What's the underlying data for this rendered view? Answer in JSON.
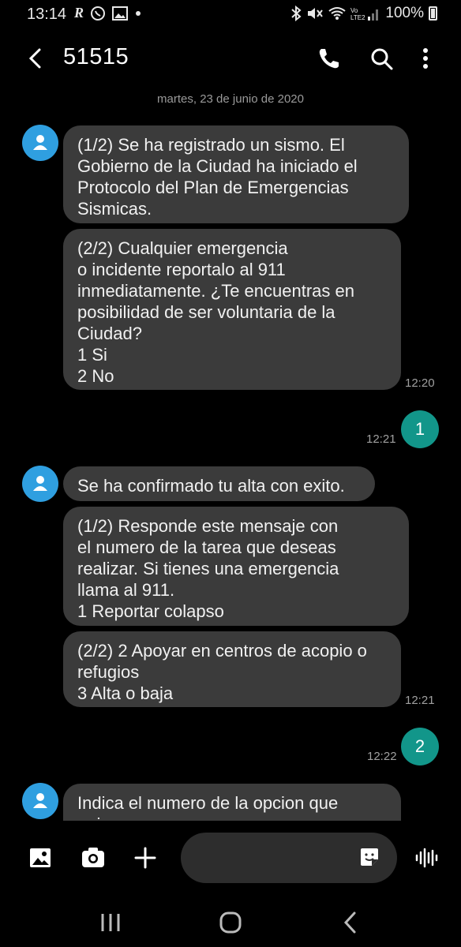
{
  "status_bar": {
    "time": "13:14",
    "battery": "100%",
    "app_icons": [
      "R",
      "whatsapp-icon",
      "gallery-icon",
      "dot-icon"
    ]
  },
  "header": {
    "title": "51515"
  },
  "date_separator": "martes, 23 de junio de 2020",
  "messages": [
    {
      "text": "(1/2) Se ha registrado un sismo. El\nGobierno de la Ciudad ha iniciado el\nProtocolo del Plan de Emergencias\nSismicas."
    },
    {
      "text": "(2/2) Cualquier emergencia\no incidente reportalo al 911\ninmediatamente. ¿Te encuentras en\nposibilidad de ser voluntaria de la\nCiudad?\n1 Si\n2 No",
      "time": "12:20"
    },
    {
      "sent": "1",
      "time": "12:21"
    },
    {
      "text": "Se ha confirmado tu alta con exito."
    },
    {
      "text": "(1/2) Responde este mensaje con\nel numero de la tarea que deseas\nrealizar. Si tienes una emergencia\nllama al 911.\n1 Reportar colapso"
    },
    {
      "text": "(2/2) 2 Apoyar en centros de acopio o\nrefugios\n3 Alta o baja",
      "time": "12:21"
    },
    {
      "sent": "2",
      "time": "12:22"
    },
    {
      "text": "Indica el numero de la opcion que\nquieres"
    }
  ],
  "input": {
    "value": "",
    "placeholder": ""
  }
}
